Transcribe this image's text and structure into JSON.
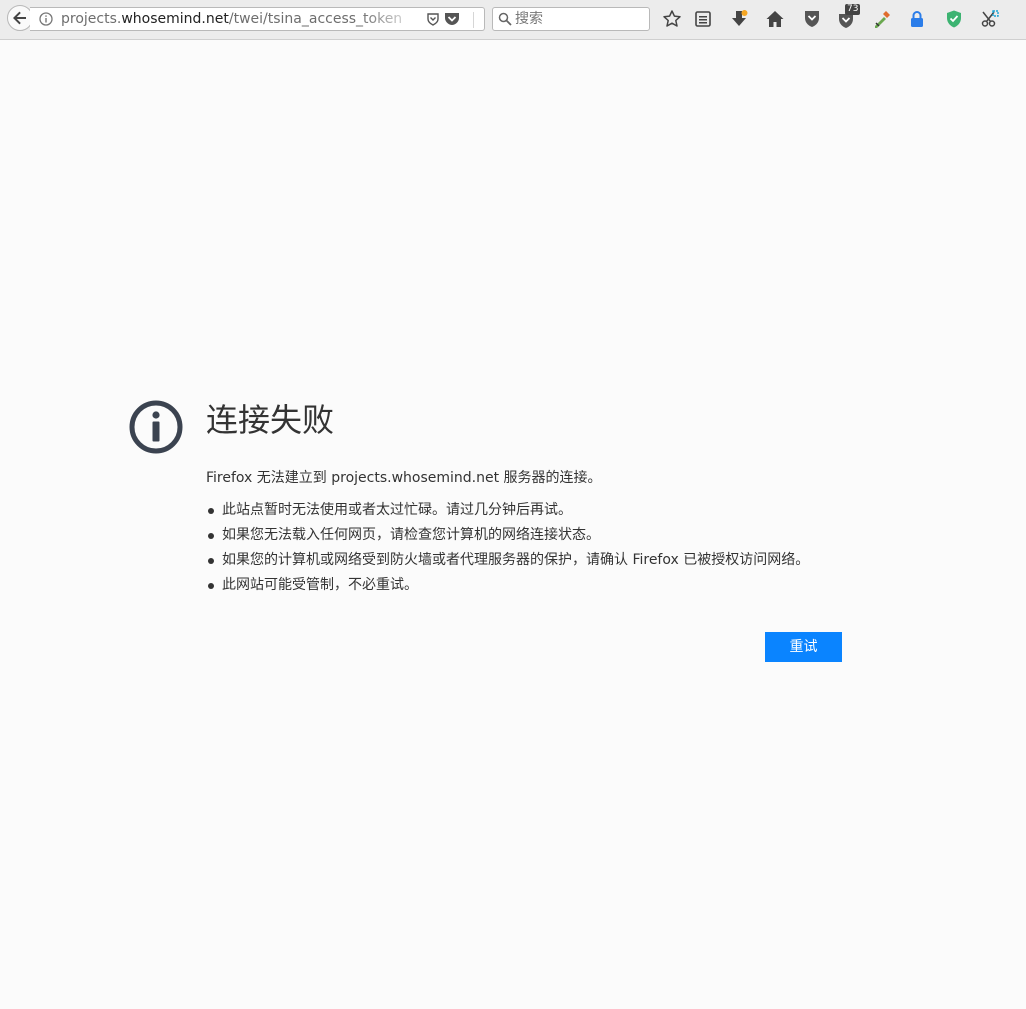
{
  "toolbar": {
    "url_prefix": "projects.",
    "url_host": "whosemind.net",
    "url_path": "/twei/tsina_access_token",
    "search_placeholder": "搜索",
    "badge_count": "73"
  },
  "error": {
    "title": "连接失败",
    "description": "Firefox 无法建立到 projects.whosemind.net 服务器的连接。",
    "reasons": [
      "此站点暂时无法使用或者太过忙碌。请过几分钟后再试。",
      "如果您无法载入任何网页，请检查您计算机的网络连接状态。",
      "如果您的计算机或网络受到防火墙或者代理服务器的保护，请确认 Firefox 已被授权访问网络。",
      "此网站可能受管制，不必重试。"
    ],
    "retry_label": "重试"
  },
  "colors": {
    "accent": "#0a84ff",
    "icon": "#3b4350"
  }
}
